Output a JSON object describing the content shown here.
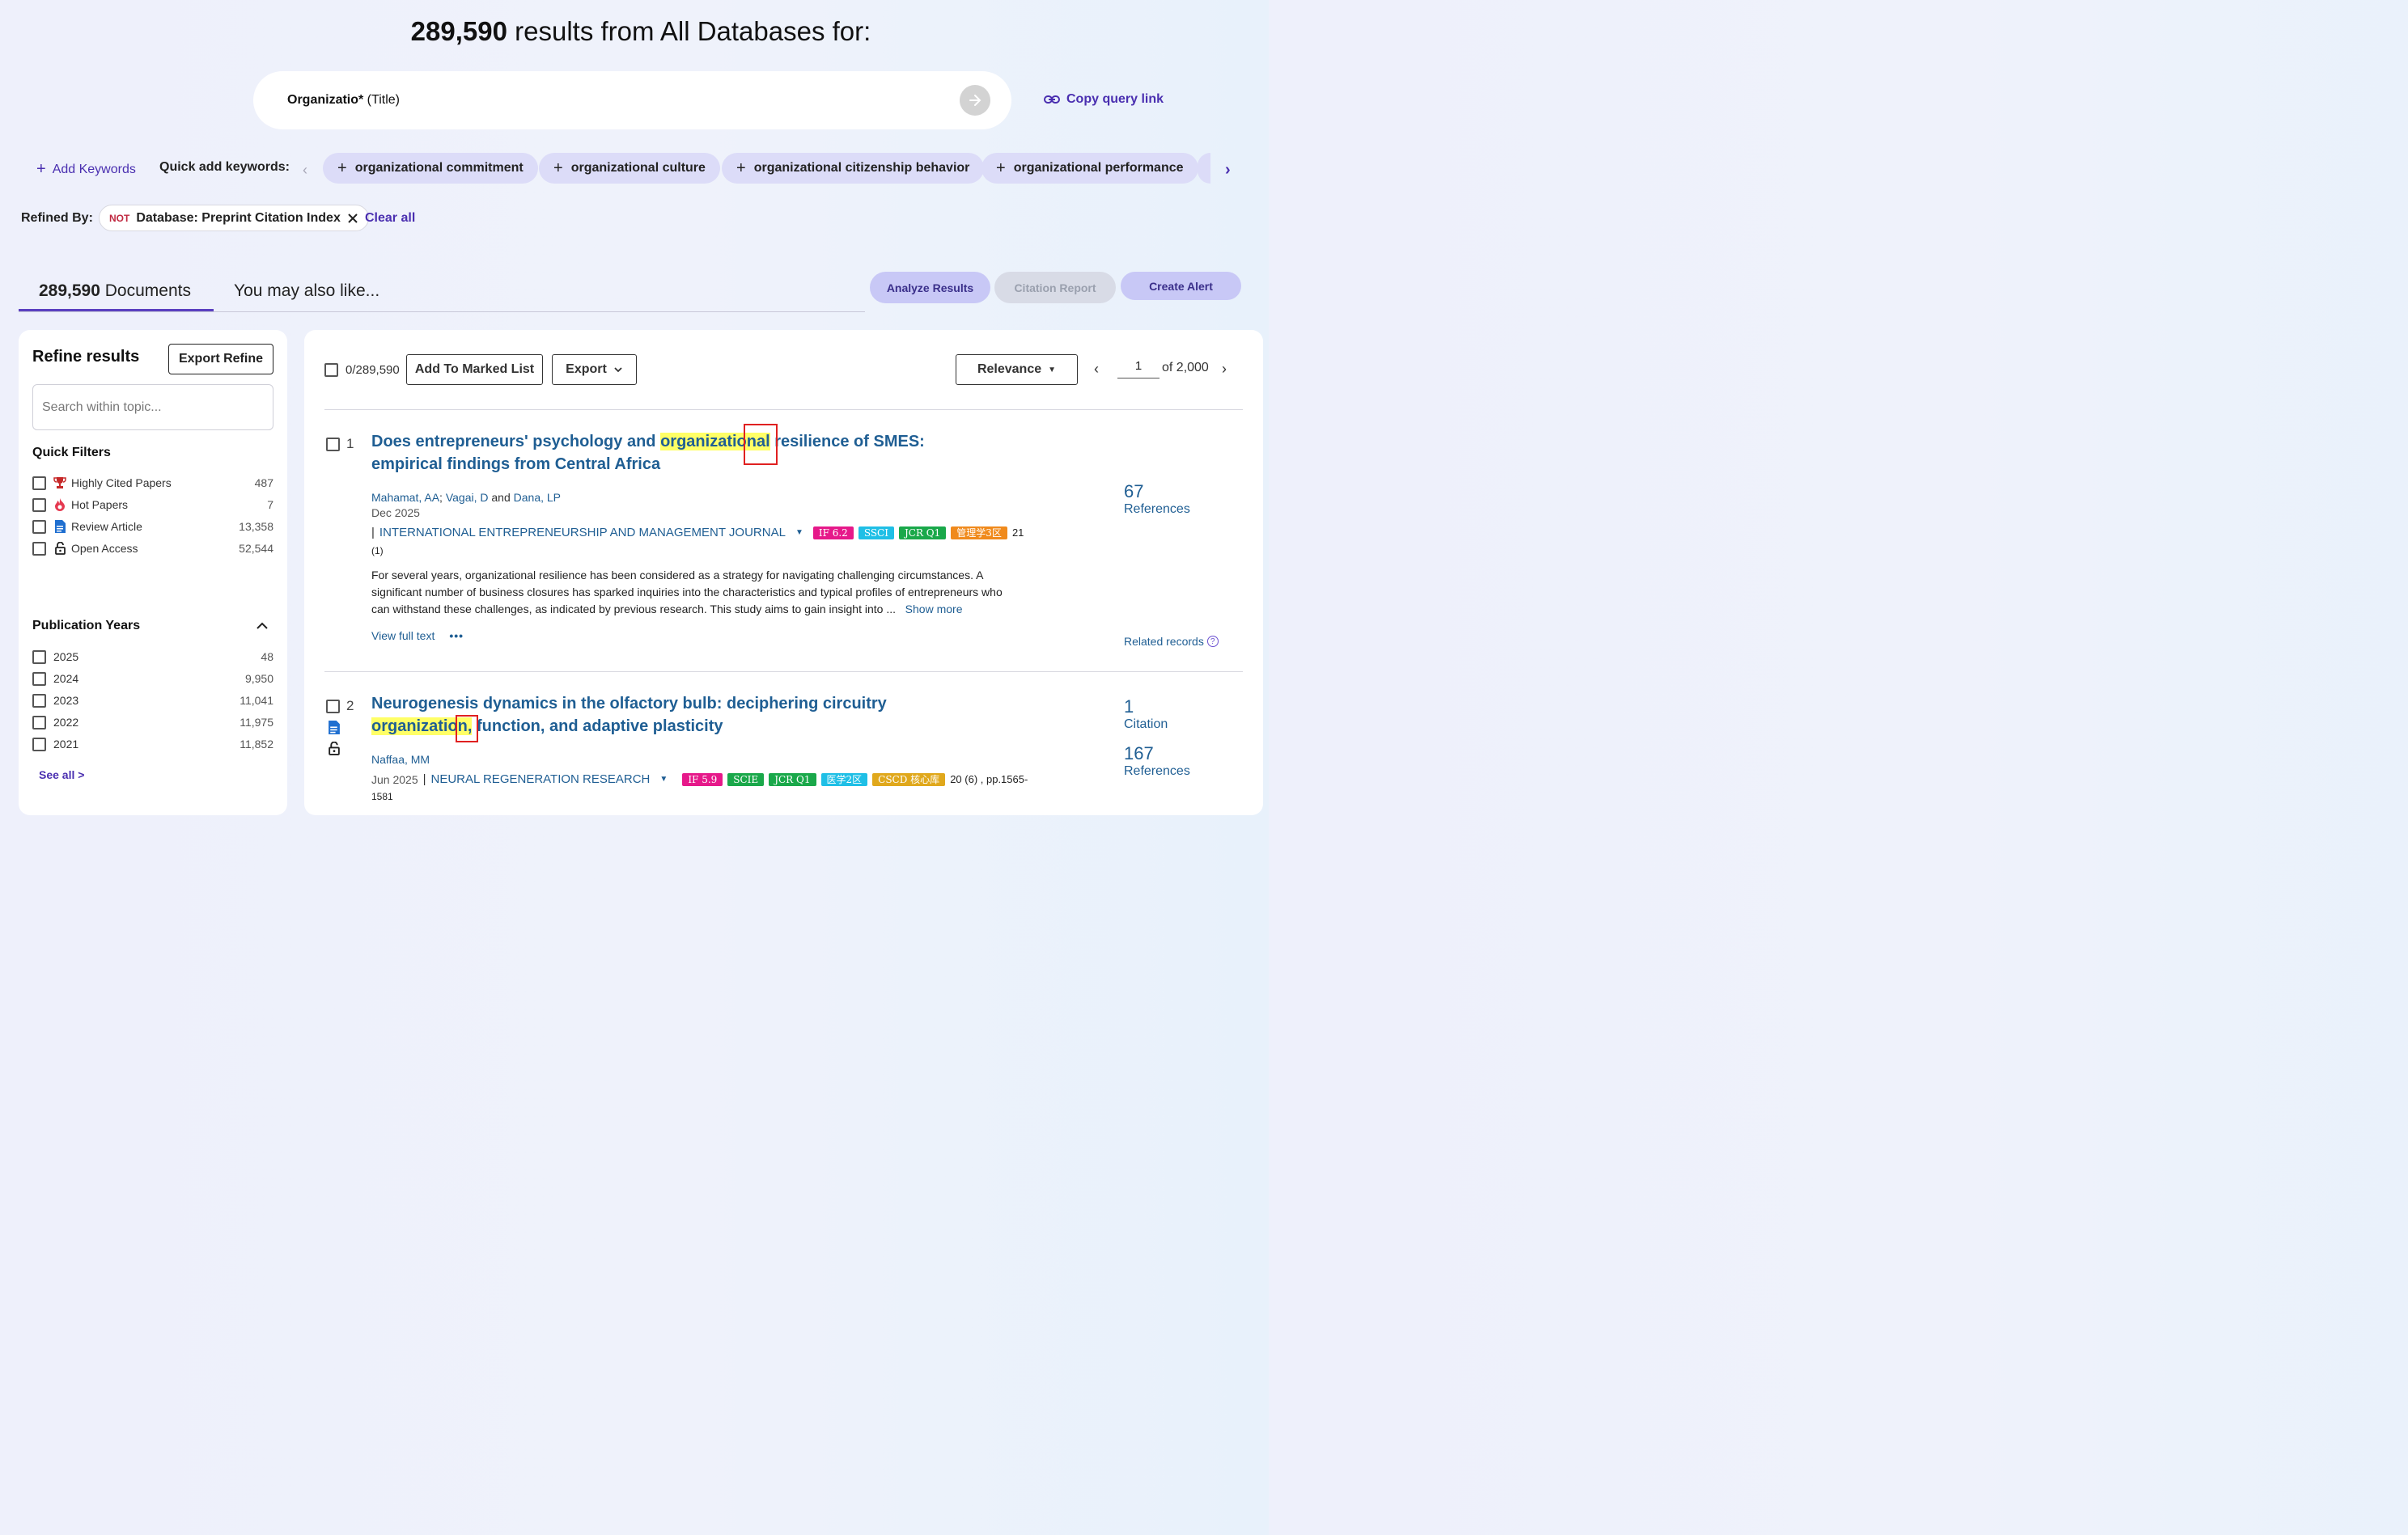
{
  "header": {
    "count": "289,590",
    "suffix": " results from All Databases for:"
  },
  "query": {
    "term": "Organizatio*",
    "field": " (Title)",
    "copy_link": "Copy query link"
  },
  "keywords": {
    "add_label": "Add Keywords",
    "quick_label": "Quick add keywords:",
    "chips": [
      "organizational commitment",
      "organizational culture",
      "organizational citizenship behavior",
      "organizational performance"
    ]
  },
  "refined": {
    "label": "Refined By:",
    "not_tag": "NOT",
    "filter": "Database: Preprint Citation Index",
    "clear_all": "Clear all"
  },
  "tabs": {
    "docs_count": "289,590",
    "docs_label": " Documents",
    "also_like": "You may also like..."
  },
  "actions": {
    "analyze": "Analyze Results",
    "citation_report": "Citation Report",
    "create_alert": "Create Alert"
  },
  "refine_panel": {
    "title": "Refine results",
    "export_label": "Export Refine",
    "search_placeholder": "Search within topic...",
    "quick_filters_title": "Quick Filters",
    "quick_filters": [
      {
        "label": "Highly Cited Papers",
        "count": "487",
        "icon": "trophy-icon",
        "color": "#c62828"
      },
      {
        "label": "Hot Papers",
        "count": "7",
        "icon": "flame-icon",
        "color": "#e53950"
      },
      {
        "label": "Review Article",
        "count": "13,358",
        "icon": "document-icon",
        "color": "#1f6fd0"
      },
      {
        "label": "Open Access",
        "count": "52,544",
        "icon": "lock-open-icon",
        "color": "#333333"
      }
    ],
    "years_title": "Publication Years",
    "years": [
      {
        "label": "2025",
        "count": "48"
      },
      {
        "label": "2024",
        "count": "9,950"
      },
      {
        "label": "2023",
        "count": "11,041"
      },
      {
        "label": "2022",
        "count": "11,975"
      },
      {
        "label": "2021",
        "count": "11,852"
      }
    ],
    "see_all": "See all >"
  },
  "toolbar": {
    "selected": "0/289,590",
    "add_marked": "Add To Marked List",
    "export": "Export",
    "sort": "Relevance",
    "page": "1",
    "of_pages": "of 2,000"
  },
  "records": [
    {
      "num": "1",
      "title_pre": "Does entrepreneurs' psychology and ",
      "title_hl_a": "organizatio",
      "title_hl_b": "nal",
      "title_post": " resilience of SMES: empirical findings from Central Africa",
      "authors": [
        "Mahamat, AA",
        "Vagai, D",
        "Dana, LP"
      ],
      "sep1": ";",
      "sep2": " and ",
      "date": "Dec 2025",
      "journal": "INTERNATIONAL ENTREPRENEURSHIP AND MANAGEMENT JOURNAL",
      "badges": [
        {
          "text": "IF 6.2",
          "color": "#e6198a"
        },
        {
          "text": "SSCI",
          "color": "#1fbfe6"
        },
        {
          "text": "JCR Q1",
          "color": "#1aa84a"
        },
        {
          "text": "管理学3区",
          "color": "#f08a1c"
        }
      ],
      "volume": "21",
      "issue": "(1)",
      "abstract": "For several years, organizational resilience has been considered as a strategy for navigating challenging circumstances. A significant number of business closures has sparked inquiries into the characteristics and typical profiles of entrepreneurs who can withstand these challenges, as indicated by previous research. This study aims to gain insight into ...",
      "show_more": "Show more",
      "view_full": "View full text",
      "refs_num": "67",
      "refs_label": "References",
      "related": "Related records"
    },
    {
      "num": "2",
      "title_pre": "Neurogenesis dynamics in the olfactory bulb: deciphering circuitry ",
      "title_hl_a": "organizatio",
      "title_hl_b": "n,",
      "title_post": " function, and adaptive plasticity",
      "authors": [
        "Naffaa, MM"
      ],
      "date": "Jun 2025",
      "journal": "NEURAL REGENERATION RESEARCH",
      "badges": [
        {
          "text": "IF 5.9",
          "color": "#e6198a"
        },
        {
          "text": "SCIE",
          "color": "#1aa84a"
        },
        {
          "text": "JCR Q1",
          "color": "#1aa84a"
        },
        {
          "text": "医学2区",
          "color": "#1fbfe6"
        },
        {
          "text": "CSCD 核心库",
          "color": "#e0a81c"
        }
      ],
      "volume": "20 (6) , pp.1565-",
      "pages_cont": "1581",
      "cit_num": "1",
      "cit_label": "Citation",
      "refs_num": "167",
      "refs_label": "References"
    }
  ]
}
